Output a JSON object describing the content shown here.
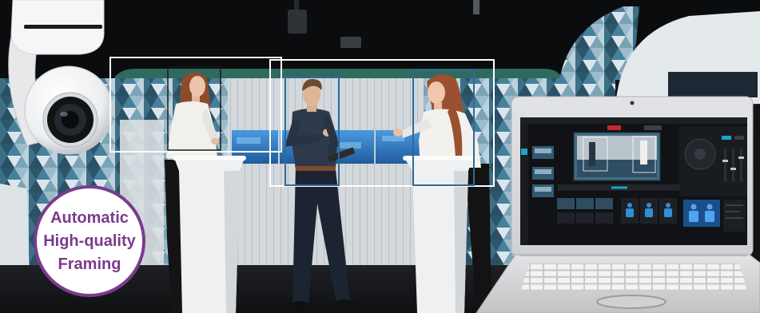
{
  "badge": {
    "lines": [
      "Automatic",
      "High-quality",
      "Framing"
    ],
    "text_color": "#7b3b8c",
    "ring_color": "#7b3b8c"
  },
  "framing": {
    "group_frame_color": "#ffffff",
    "subject_frame_color": "#2d6a98",
    "secondary_subject_frame_color": "#1a1a1a"
  },
  "laptop_ui": {
    "record_button_color": "#c8262c",
    "accent_color": "#1fa3c6"
  }
}
